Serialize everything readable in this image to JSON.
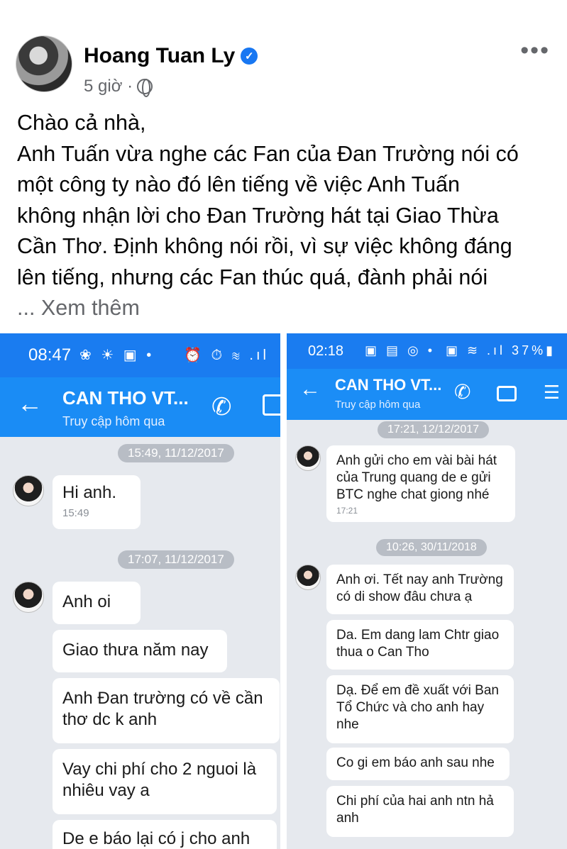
{
  "post": {
    "author": "Hoang Tuan Ly",
    "time": "5 giờ ·",
    "more_icon": "•••",
    "lines": [
      "Chào cả nhà,",
      "Anh Tuấn vừa nghe các Fan của Đan Trường nói có",
      "một công ty nào đó lên tiếng về việc Anh Tuấn",
      "không nhận lời cho Đan Trường hát tại Giao Thừa",
      "Cần Thơ. Định không nói rồi, vì sự việc không đáng",
      "lên tiếng, nhưng các Fan thúc quá, đành phải nói"
    ],
    "see_more": "... Xem thêm"
  },
  "left_shot": {
    "status_time": "08:47",
    "status_icons": "❀ ☀ ▣ •",
    "status_right": "⏰ ⏱ ≋ .ıl",
    "contact": "CAN THO VT...",
    "sub": "Truy cập hôm qua",
    "messages": [
      {
        "date": "15:49, 11/12/2017"
      },
      {
        "text": "Hi anh.",
        "time": "15:49"
      },
      {
        "date": "17:07, 11/12/2017"
      },
      {
        "text": "Anh oi"
      },
      {
        "text": "Giao thưa năm nay"
      },
      {
        "text": "Anh Đan trường có về cần thơ dc k anh"
      },
      {
        "text": "Vay chi phí cho 2 nguoi là nhiêu vay a"
      },
      {
        "text": "De e báo lại có j cho anh"
      }
    ]
  },
  "right_shot": {
    "status_time": "02:18",
    "status_icons": "▣ ▤ ◎ •",
    "status_right": "▣ ≋ .ıl 37%▮",
    "contact": "CAN THO VT...",
    "sub": "Truy cập hôm qua",
    "messages": [
      {
        "date": "17:21, 12/12/2017"
      },
      {
        "text": "Anh gửi cho em vài bài hát của Trung quang de e gửi BTC nghe chat giong nhé",
        "time": "17:21"
      },
      {
        "date": "10:26, 30/11/2018"
      },
      {
        "text": "Anh ơi. Tết nay anh Trường có di show đâu chưa ạ"
      },
      {
        "text": "Da. Em dang lam Chtr giao thua o Can Tho"
      },
      {
        "text": "Dạ. Để em đề xuất với Ban Tổ Chức và cho anh hay nhe"
      },
      {
        "text": "Co gi em báo anh sau nhe"
      },
      {
        "text": "Chi phí của hai anh ntn hả anh"
      }
    ]
  },
  "icons": {
    "back": "←",
    "call": "✆",
    "menu": "☰",
    "verified": "✓"
  },
  "colors": {
    "status_bar": "#1a7cf0",
    "chat_header": "#1a8cf5",
    "chat_bg": "#e6e9ee",
    "verified": "#1877f2"
  }
}
